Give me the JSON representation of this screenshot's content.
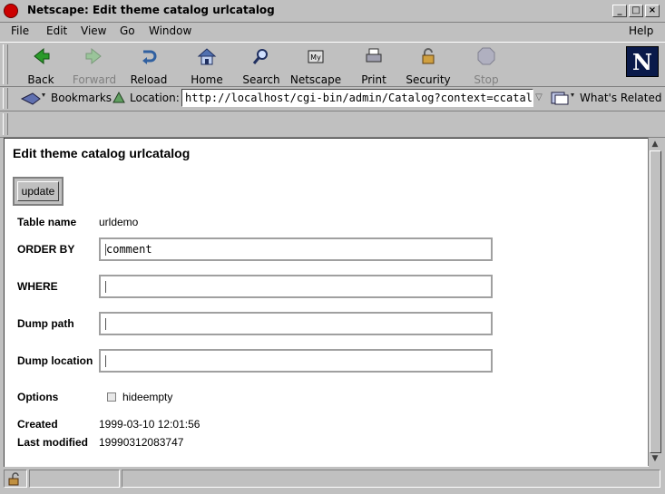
{
  "window": {
    "title": "Netscape: Edit theme catalog urlcatalog"
  },
  "menubar": {
    "items": [
      "File",
      "Edit",
      "View",
      "Go",
      "Window"
    ],
    "help": "Help"
  },
  "toolbar": {
    "buttons": [
      {
        "label": "Back",
        "icon": "back-arrow-icon",
        "enabled": true
      },
      {
        "label": "Forward",
        "icon": "forward-arrow-icon",
        "enabled": false
      },
      {
        "label": "Reload",
        "icon": "reload-icon",
        "enabled": true
      },
      {
        "label": "Home",
        "icon": "home-icon",
        "enabled": true
      },
      {
        "label": "Search",
        "icon": "search-icon",
        "enabled": true
      },
      {
        "label": "Netscape",
        "icon": "netscape-icon",
        "enabled": true
      },
      {
        "label": "Print",
        "icon": "print-icon",
        "enabled": true
      },
      {
        "label": "Security",
        "icon": "lock-icon",
        "enabled": true
      },
      {
        "label": "Stop",
        "icon": "stop-icon",
        "enabled": false
      }
    ],
    "logo_letter": "N"
  },
  "locationbar": {
    "bookmarks_label": "Bookmarks",
    "location_label": "Location:",
    "url": "http://localhost/cgi-bin/admin/Catalog?context=ccatalo",
    "whats_related": "What's Related"
  },
  "page": {
    "heading": "Edit theme catalog urlcatalog",
    "update_label": "update",
    "table_name_label": "Table name",
    "table_name_value": "urldemo",
    "order_by_label": "ORDER BY",
    "order_by_value": "comment",
    "where_label": "WHERE",
    "where_value": "",
    "dump_path_label": "Dump path",
    "dump_path_value": "",
    "dump_location_label": "Dump location",
    "dump_location_value": "",
    "options_label": "Options",
    "hideempty_label": "hideempty",
    "created_label": "Created",
    "created_value": "1999-03-10 12:01:56",
    "last_modified_label": "Last modified",
    "last_modified_value": "19990312083747"
  }
}
